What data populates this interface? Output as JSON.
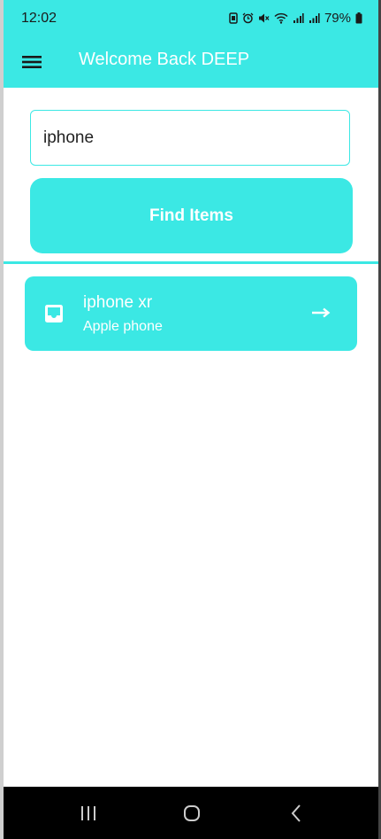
{
  "status_bar": {
    "time": "12:02",
    "battery": "79%",
    "icons": [
      "lock-battery-icon",
      "alarm-icon",
      "mute-icon",
      "wifi-icon",
      "signal-icon",
      "signal-icon-2",
      "battery-icon"
    ]
  },
  "app_bar": {
    "title": "Welcome Back DEEP",
    "menu_icon": "hamburger-menu-icon"
  },
  "search": {
    "value": "iphone",
    "placeholder": ""
  },
  "find_button": {
    "label": "Find Items"
  },
  "results": [
    {
      "title": "iphone xr",
      "subtitle": "Apple phone",
      "icon": "inbox-icon",
      "action_icon": "arrow-right-icon"
    }
  ],
  "nav_bar": {
    "buttons": [
      "recent-apps-icon",
      "home-icon",
      "back-icon"
    ]
  },
  "colors": {
    "accent": "#3be8e4",
    "text_on_accent": "#ffffff",
    "nav_bg": "#000000"
  }
}
